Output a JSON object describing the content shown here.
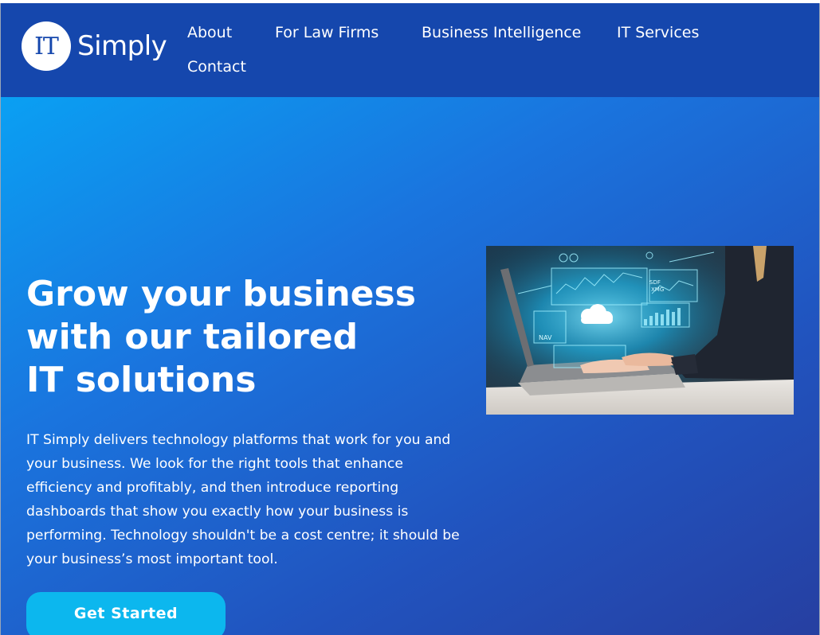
{
  "brand": {
    "logo_initials": "IT",
    "logo_word": "Simply",
    "header_color": "#1547ad",
    "accent_button": "#0cb7ee"
  },
  "nav": {
    "items": [
      {
        "label": "About"
      },
      {
        "label": "For Law Firms"
      },
      {
        "label": "Business Intelligence"
      },
      {
        "label": "IT Services"
      },
      {
        "label": "Contact"
      }
    ]
  },
  "hero": {
    "headline_lines": [
      "Grow your business",
      "with our tailored",
      "IT solutions"
    ],
    "intro": "IT Simply delivers technology platforms that work for you and your business. We look for the right tools that enhance efficiency and profitably, and then introduce reporting dashboards that show you exactly how your business is performing. Technology shouldn't be a cost centre; it should be your business’s most important tool.",
    "cta_label": "Get Started",
    "image_overlay_labels": [
      "SDF",
      "XMG",
      "NAV"
    ]
  }
}
